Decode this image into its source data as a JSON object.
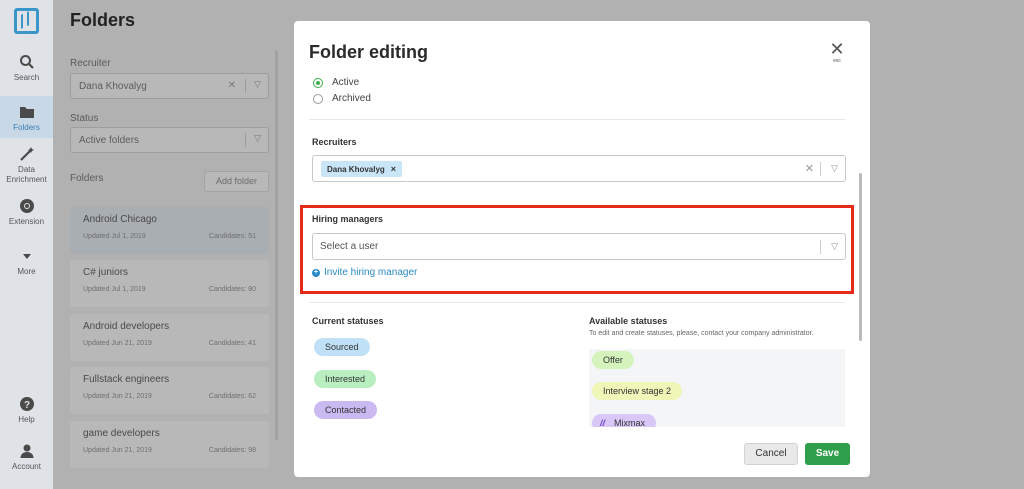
{
  "rail": {
    "items": [
      {
        "label": "Search",
        "icon": "search-icon"
      },
      {
        "label": "Folders",
        "icon": "folder-icon"
      },
      {
        "label": "Data Enrichment",
        "icon": "magic-wand-icon"
      },
      {
        "label": "Extension",
        "icon": "chrome-icon"
      },
      {
        "label": "More",
        "icon": "chevron-down-icon"
      },
      {
        "label": "Help",
        "icon": "help-icon"
      },
      {
        "label": "Account",
        "icon": "user-icon"
      }
    ]
  },
  "page": {
    "title": "Folders",
    "recruiter_label": "Recruiter",
    "recruiter_value": "Dana Khovalyg",
    "status_label": "Status",
    "status_value": "Active folders",
    "folders_label": "Folders",
    "add_folder": "Add folder",
    "folders": [
      {
        "name": "Android Chicago",
        "updated": "Updated Jul 1, 2019",
        "candidates": "Candidates: 51"
      },
      {
        "name": "C# juniors",
        "updated": "Updated Jul 1, 2019",
        "candidates": "Candidates: 80"
      },
      {
        "name": "Android developers",
        "updated": "Updated Jun 21, 2019",
        "candidates": "Candidates: 41"
      },
      {
        "name": "Fullstack engineers",
        "updated": "Updated Jun 21, 2019",
        "candidates": "Candidates: 62"
      },
      {
        "name": "game developers",
        "updated": "Updated Jun 21, 2019",
        "candidates": "Candidates: 98"
      }
    ]
  },
  "modal": {
    "title": "Folder editing",
    "close_hint": "esc",
    "status_options": [
      {
        "label": "Active",
        "selected": true
      },
      {
        "label": "Archived",
        "selected": false
      }
    ],
    "recruiters_label": "Recruiters",
    "recruiter_tag": "Dana Khovalyg",
    "hiring_managers_label": "Hiring managers",
    "hiring_managers_placeholder": "Select a user",
    "invite_label": "Invite hiring manager",
    "current_statuses_label": "Current statuses",
    "current_statuses": [
      {
        "label": "Sourced",
        "color": "#bfe0f7"
      },
      {
        "label": "Interested",
        "color": "#b9efc0"
      },
      {
        "label": "Contacted",
        "color": "#cbb9f2"
      }
    ],
    "available_statuses_label": "Available statuses",
    "available_note": "To edit and create statuses, please, contact your company administrator.",
    "available_statuses": [
      {
        "label": "Offer",
        "color": "#d4f3bd"
      },
      {
        "label": "Interview stage 2",
        "color": "#eef6b8"
      },
      {
        "label": "Mixmax",
        "color": "#d8c7f7"
      }
    ],
    "cancel_label": "Cancel",
    "save_label": "Save"
  },
  "colors": {
    "accent_green": "#2f9e4b",
    "link_blue": "#2b8ac6",
    "highlight_red": "#e62a1a"
  }
}
